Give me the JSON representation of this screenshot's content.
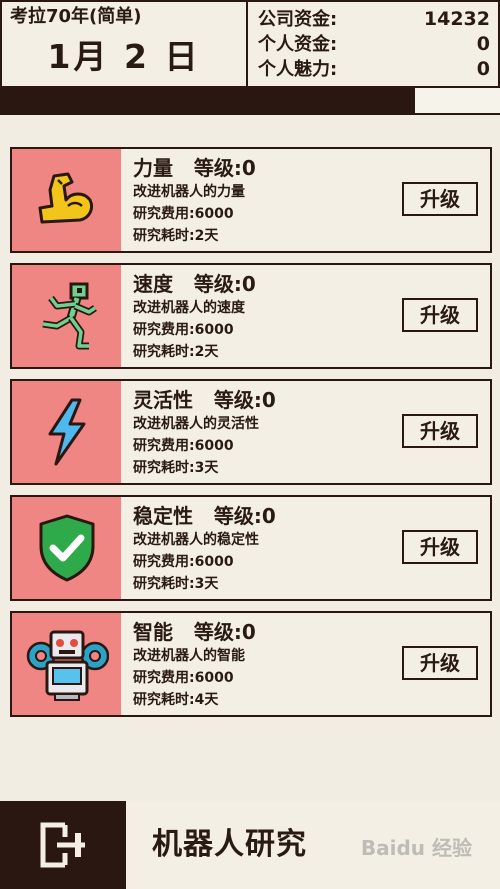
{
  "header": {
    "mode_title": "考拉70年(简单)",
    "date": "1月 2 日",
    "stats": [
      {
        "label": "公司资金:",
        "value": "14232"
      },
      {
        "label": "个人资金:",
        "value": "0"
      },
      {
        "label": "个人魅力:",
        "value": "0"
      }
    ],
    "progress": 0.83
  },
  "research": [
    {
      "title": "力量   等级:0",
      "desc": "改进机器人的力量",
      "cost": "研究费用:6000",
      "time": "研究耗时:2天",
      "button": "升级",
      "icon": "flexed-arm-icon"
    },
    {
      "title": "速度   等级:0",
      "desc": "改进机器人的速度",
      "cost": "研究费用:6000",
      "time": "研究耗时:2天",
      "button": "升级",
      "icon": "running-robot-icon"
    },
    {
      "title": "灵活性   等级:0",
      "desc": "改进机器人的灵活性",
      "cost": "研究费用:6000",
      "time": "研究耗时:3天",
      "button": "升级",
      "icon": "lightning-icon"
    },
    {
      "title": "稳定性   等级:0",
      "desc": "改进机器人的稳定性",
      "cost": "研究费用:6000",
      "time": "研究耗时:3天",
      "button": "升级",
      "icon": "shield-check-icon"
    },
    {
      "title": "智能   等级:0",
      "desc": "改进机器人的智能",
      "cost": "研究费用:6000",
      "time": "研究耗时:4天",
      "button": "升级",
      "icon": "robot-gear-icon"
    }
  ],
  "footer": {
    "title": "机器人研究",
    "back_icon": "exit-door-icon",
    "watermark": "Baidu 经验"
  },
  "colors": {
    "dark": "#2b1712",
    "background": "#f1ede3",
    "icon_bg": "#f08683"
  }
}
